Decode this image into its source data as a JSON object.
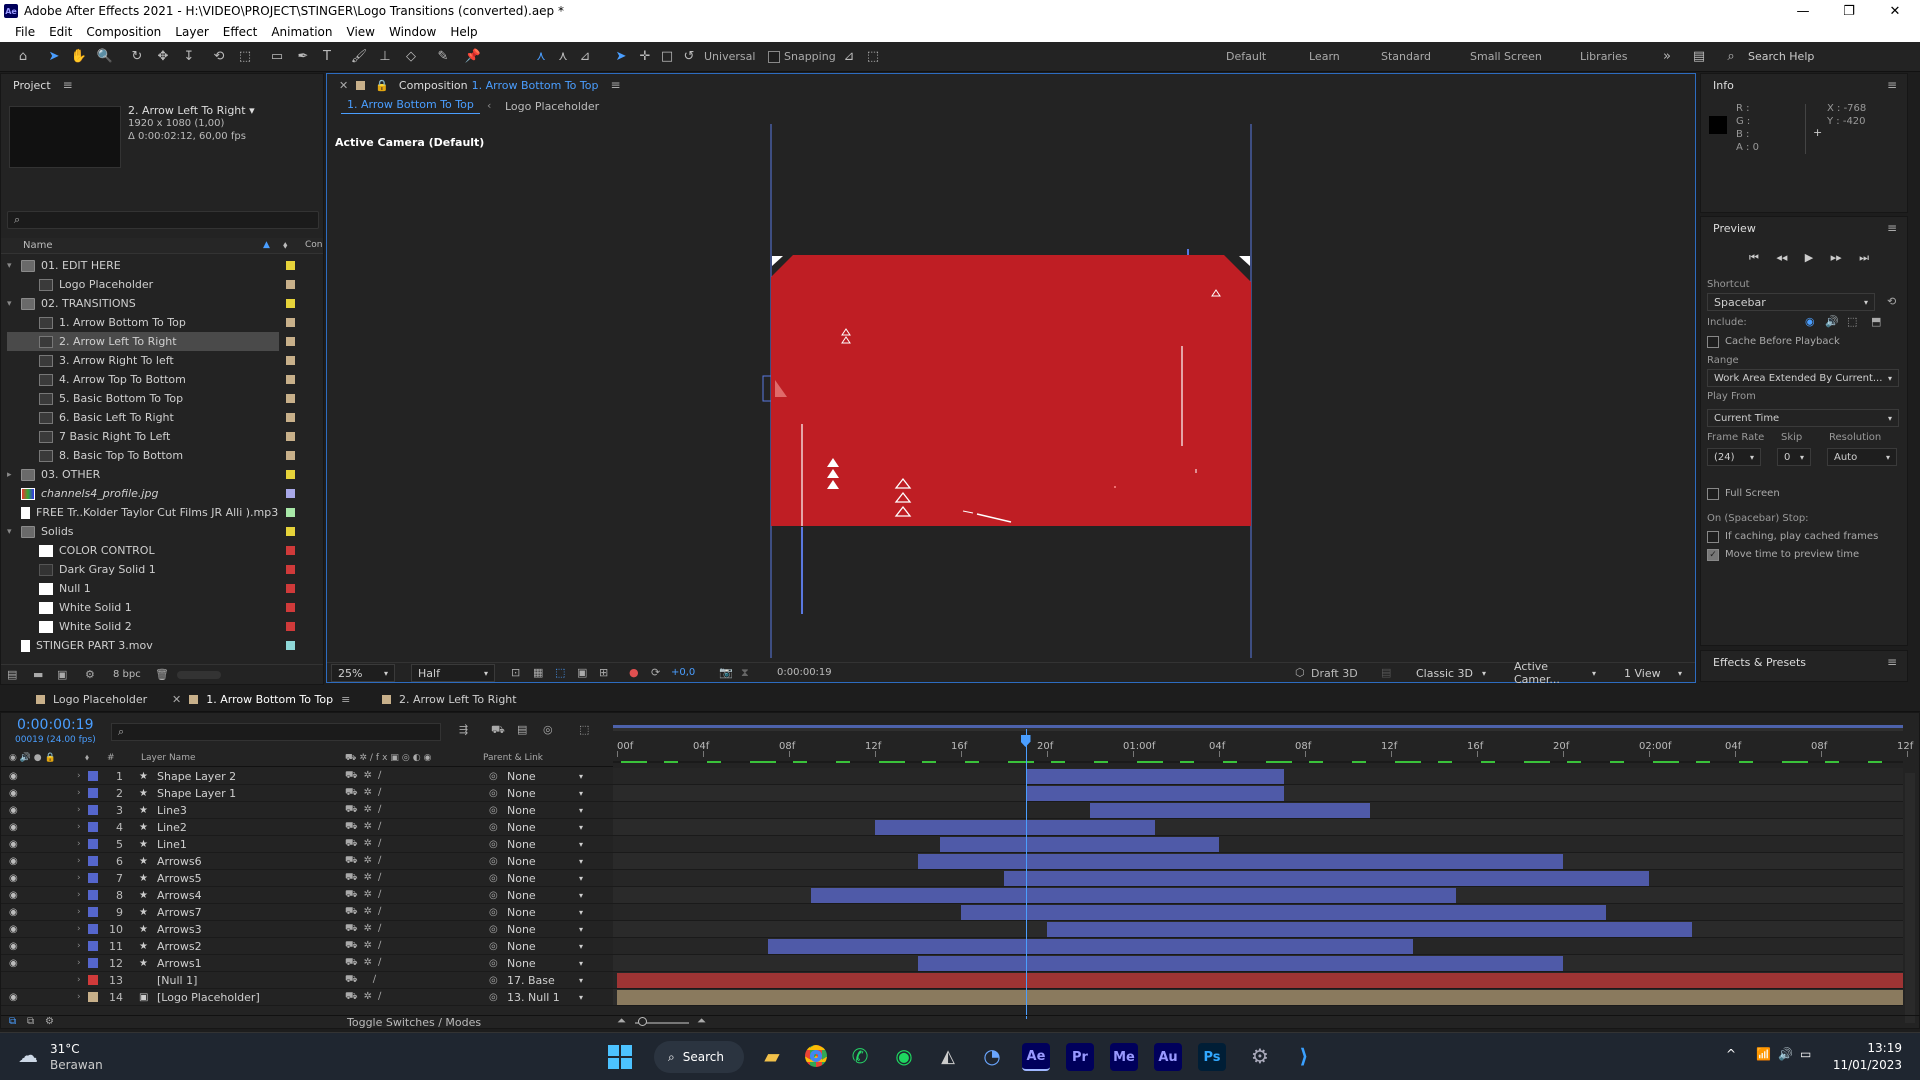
{
  "window": {
    "title": "Adobe After Effects 2021 - H:\\VIDEO\\PROJECT\\STINGER\\Logo Transitions (converted).aep *",
    "app_icon": "Ae"
  },
  "menu": [
    "File",
    "Edit",
    "Composition",
    "Layer",
    "Effect",
    "Animation",
    "View",
    "Window",
    "Help"
  ],
  "toolbar": {
    "universal": "Universal",
    "snapping": "Snapping",
    "workspaces": [
      "Default",
      "Learn",
      "Standard",
      "Small Screen",
      "Libraries"
    ],
    "search_help": "Search Help"
  },
  "project": {
    "title": "Project",
    "selected_name": "2. Arrow Left To Right",
    "selected_dims": "1920 x 1080 (1,00)",
    "selected_dur": "Δ 0:00:02:12, 60,00 fps",
    "col_name": "Name",
    "col_com": "Con",
    "bpc": "8 bpc",
    "items": [
      {
        "name": "01. EDIT HERE",
        "type": "folder",
        "tw": "▾",
        "indent": 0,
        "color": "#e6d33a"
      },
      {
        "name": "Logo Placeholder",
        "type": "comp",
        "tw": "",
        "indent": 1,
        "color": "#c8b08a"
      },
      {
        "name": "02. TRANSITIONS",
        "type": "folder",
        "tw": "▾",
        "indent": 0,
        "color": "#e6d33a"
      },
      {
        "name": "1. Arrow Bottom To Top",
        "type": "comp",
        "tw": "",
        "indent": 1,
        "color": "#c8b08a"
      },
      {
        "name": "2. Arrow Left To Right",
        "type": "comp",
        "tw": "",
        "indent": 1,
        "color": "#c8b08a",
        "sel": true
      },
      {
        "name": "3. Arrow Right To left",
        "type": "comp",
        "tw": "",
        "indent": 1,
        "color": "#c8b08a"
      },
      {
        "name": "4. Arrow Top To Bottom",
        "type": "comp",
        "tw": "",
        "indent": 1,
        "color": "#c8b08a"
      },
      {
        "name": "5. Basic Bottom To Top",
        "type": "comp",
        "tw": "",
        "indent": 1,
        "color": "#c8b08a"
      },
      {
        "name": "6. Basic Left To Right",
        "type": "comp",
        "tw": "",
        "indent": 1,
        "color": "#c8b08a"
      },
      {
        "name": "7 Basic Right To Left",
        "type": "comp",
        "tw": "",
        "indent": 1,
        "color": "#c8b08a"
      },
      {
        "name": "8. Basic Top To Bottom",
        "type": "comp",
        "tw": "",
        "indent": 1,
        "color": "#c8b08a"
      },
      {
        "name": "03. OTHER",
        "type": "folder",
        "tw": "▸",
        "indent": 0,
        "color": "#e6d33a"
      },
      {
        "name": "channels4_profile.jpg",
        "type": "img",
        "tw": "",
        "indent": 0,
        "color": "#a8a8e8",
        "italic": true
      },
      {
        "name": "FREE Tr..Kolder   Taylor Cut Films   JR Alli ).mp3",
        "type": "file",
        "tw": "",
        "indent": 0,
        "color": "#a8e8a8"
      },
      {
        "name": "Solids",
        "type": "folder",
        "tw": "▾",
        "indent": 0,
        "color": "#e6d33a"
      },
      {
        "name": "COLOR CONTROL",
        "type": "solid",
        "tw": "",
        "indent": 1,
        "color": "#d03a3a"
      },
      {
        "name": "Dark Gray Solid 1",
        "type": "solid-dark",
        "tw": "",
        "indent": 1,
        "color": "#d03a3a"
      },
      {
        "name": "Null 1",
        "type": "solid",
        "tw": "",
        "indent": 1,
        "color": "#d03a3a"
      },
      {
        "name": "White Solid 1",
        "type": "solid",
        "tw": "",
        "indent": 1,
        "color": "#d03a3a"
      },
      {
        "name": "White Solid 2",
        "type": "solid",
        "tw": "",
        "indent": 1,
        "color": "#d03a3a"
      },
      {
        "name": "STINGER PART 3.mov",
        "type": "file",
        "tw": "",
        "indent": 0,
        "color": "#8fd8d8"
      }
    ]
  },
  "composition": {
    "panel_label": "Composition",
    "comp_name": "1. Arrow Bottom To Top",
    "flow_active": "1. Arrow Bottom To Top",
    "flow_other": "Logo Placeholder",
    "camera_label": "Active Camera (Default)",
    "zoom": "25%",
    "resolution": "Half",
    "exposure": "+0,0",
    "time": "0:00:00:19",
    "renderer_mode": "Draft 3D",
    "renderer": "Classic 3D",
    "camera_select": "Active Camer...",
    "view_count": "1 View",
    "accent": "#bf1e24"
  },
  "info": {
    "title": "Info",
    "r": "R :",
    "g": "G :",
    "b": "B :",
    "a": "A : 0",
    "x": "X : -768",
    "y": "Y : -420"
  },
  "preview": {
    "title": "Preview",
    "shortcut_label": "Shortcut",
    "shortcut": "Spacebar",
    "include_label": "Include:",
    "cache": "Cache Before Playback",
    "range_label": "Range",
    "range": "Work Area Extended By Current...",
    "playfrom_label": "Play From",
    "playfrom": "Current Time",
    "fr_label": "Frame Rate",
    "skip_label": "Skip",
    "res_label": "Resolution",
    "fr": "(24)",
    "skip": "0",
    "res": "Auto",
    "fullscreen": "Full Screen",
    "stop_label": "On (Spacebar) Stop:",
    "if_caching": "If caching, play cached frames",
    "move_time": "Move time to preview time"
  },
  "effects": {
    "title": "Effects & Presets"
  },
  "timeline": {
    "tabs": [
      "Logo Placeholder",
      "1. Arrow Bottom To Top",
      "2. Arrow Left To Right"
    ],
    "timecode": "0:00:00:19",
    "frames": "00019 (24.00 fps)",
    "col_layer": "Layer Name",
    "col_parent": "Parent & Link",
    "toggle": "Toggle Switches / Modes",
    "ticks": [
      "00f",
      "04f",
      "08f",
      "12f",
      "16f",
      "20f",
      "01:00f",
      "04f",
      "08f",
      "12f",
      "16f",
      "20f",
      "02:00f",
      "04f",
      "08f",
      "12f"
    ],
    "playhead_frame": 19,
    "layers": [
      {
        "n": "1",
        "name": "Shape Layer 2",
        "parent": "None",
        "color": "#5566cc",
        "in": 19,
        "out": 31
      },
      {
        "n": "2",
        "name": "Shape Layer 1",
        "parent": "None",
        "color": "#5566cc",
        "in": 19,
        "out": 31
      },
      {
        "n": "3",
        "name": "Line3",
        "parent": "None",
        "color": "#5566cc",
        "in": 22,
        "out": 35
      },
      {
        "n": "4",
        "name": "Line2",
        "parent": "None",
        "color": "#5566cc",
        "in": 12,
        "out": 25
      },
      {
        "n": "5",
        "name": "Line1",
        "parent": "None",
        "color": "#5566cc",
        "in": 15,
        "out": 28
      },
      {
        "n": "6",
        "name": "Arrows6",
        "parent": "None",
        "color": "#5566cc",
        "in": 14,
        "out": 44
      },
      {
        "n": "7",
        "name": "Arrows5",
        "parent": "None",
        "color": "#5566cc",
        "in": 18,
        "out": 48
      },
      {
        "n": "8",
        "name": "Arrows4",
        "parent": "None",
        "color": "#5566cc",
        "in": 9,
        "out": 39
      },
      {
        "n": "9",
        "name": "Arrows7",
        "parent": "None",
        "color": "#5566cc",
        "in": 16,
        "out": 46
      },
      {
        "n": "10",
        "name": "Arrows3",
        "parent": "None",
        "color": "#5566cc",
        "in": 20,
        "out": 50
      },
      {
        "n": "11",
        "name": "Arrows2",
        "parent": "None",
        "color": "#5566cc",
        "in": 7,
        "out": 37
      },
      {
        "n": "12",
        "name": "Arrows1",
        "parent": "None",
        "color": "#5566cc",
        "in": 14,
        "out": 44
      },
      {
        "n": "13",
        "name": "[Null 1]",
        "parent": "17. Base",
        "color": "#d03a3a",
        "in": 0,
        "out": 60,
        "null": true
      },
      {
        "n": "14",
        "name": "[Logo Placeholder]",
        "parent": "13. Null 1",
        "color": "#c8b08a",
        "in": 0,
        "out": 60,
        "logo": true
      }
    ]
  },
  "taskbar": {
    "temp": "31°C",
    "weather": "Berawan",
    "search": "Search",
    "time": "13:19",
    "date": "11/01/2023",
    "apps": [
      "Ae",
      "Pr",
      "Me",
      "Au",
      "Ps"
    ]
  }
}
